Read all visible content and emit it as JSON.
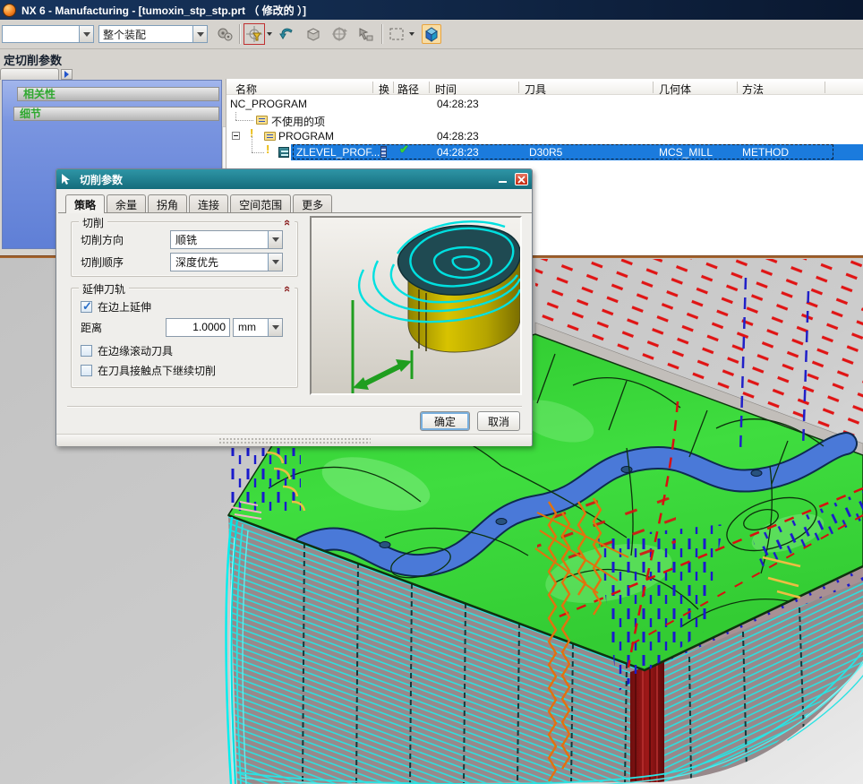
{
  "titlebar": {
    "title": "NX 6 - Manufacturing - [tumoxin_stp_stp.prt （ 修改的 ）]"
  },
  "toolbar": {
    "combo_empty": "",
    "combo_assembly": "整个装配"
  },
  "cue": {
    "label": "定切削参数"
  },
  "sidebar": {
    "dependencies": "相关性",
    "details": "细节"
  },
  "navigator": {
    "columns": {
      "name": "名称",
      "toolchange": "换",
      "path": "路径",
      "time": "时间",
      "tool": "刀具",
      "geometry": "几何体",
      "method": "方法"
    },
    "rows": [
      {
        "name": "NC_PROGRAM",
        "time": "04:28:23"
      },
      {
        "name": "不使用的项"
      },
      {
        "name": "PROGRAM",
        "time": "04:28:23"
      },
      {
        "name": "ZLEVEL_PROF...",
        "time": "04:28:23",
        "tool": "D30R5",
        "geometry": "MCS_MILL",
        "method": "METHOD"
      }
    ]
  },
  "dialog": {
    "title": "切削参数",
    "tabs": [
      "策略",
      "余量",
      "拐角",
      "连接",
      "空间范围",
      "更多"
    ],
    "cutting_group": {
      "title": "切削",
      "direction_label": "切削方向",
      "direction_value": "顺铣",
      "order_label": "切削顺序",
      "order_value": "深度优先"
    },
    "extend_group": {
      "title": "延伸刀轨",
      "extend_on_edges": "在边上延伸",
      "distance_label": "距离",
      "distance_value": "1.0000",
      "unit": "mm",
      "roll_tool": "在边缘滚动刀具",
      "continue_under_contact": "在刀具接触点下继续切削"
    },
    "ok": "确定",
    "cancel": "取消"
  },
  "colors": {
    "selection_blue": "#1B7BDD",
    "dialog_teal": "#1D7A8C",
    "divider_brown": "#A5642E",
    "surface_green": "#3FD83F",
    "toolpath_cyan": "#00E8E8",
    "engage_red": "#E01414",
    "retract_blue": "#1A1ACC",
    "stepover_orange": "#E2720E"
  }
}
